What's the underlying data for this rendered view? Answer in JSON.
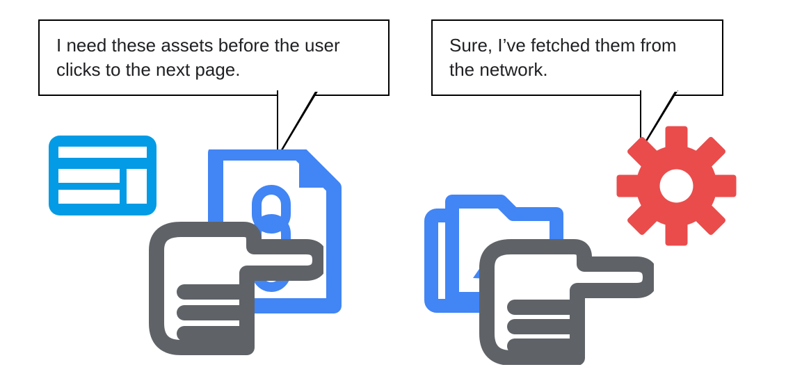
{
  "bubbles": {
    "left": "I need these assets before the user clicks to the next page.",
    "right": "Sure, I’ve fetched them from the network."
  },
  "colors": {
    "blue_bright": "#039be5",
    "blue_mid": "#4285f4",
    "blue_dark": "#1a73e8",
    "red": "#ea4c4c",
    "gray": "#5f6368"
  },
  "icons": {
    "webpage": "webpage-layout-icon",
    "document": "linked-document-icon",
    "hand_left": "hand-pointing-right-icon",
    "gallery": "image-gallery-folder-icon",
    "hand_right": "hand-pointing-right-icon",
    "gear": "gear-icon"
  }
}
